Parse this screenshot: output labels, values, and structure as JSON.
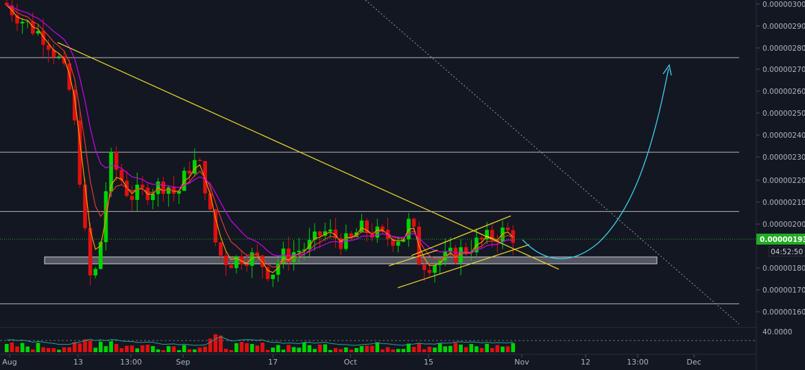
{
  "colors": {
    "background": "#131722",
    "up": "#00d600",
    "down": "#e01010",
    "axis_text": "#b2b5be",
    "level_line": "#b8b8b8",
    "trend_line": "#e6d22a",
    "ema_fast": "#ff9800",
    "ema_mid": "#e53935",
    "ema_slow": "#d500f9",
    "projection": "#3cc8e6",
    "current_price_bg": "#22ab23",
    "support_zone": "#8a8d96"
  },
  "chart_data": [
    {
      "type": "candlestick",
      "title": "",
      "x_ticks": [
        "Aug",
        "13",
        "13:00",
        "Sep",
        "17",
        "Oct",
        "15",
        "Nov",
        "12",
        "13:00",
        "Dec"
      ],
      "y_ticks": [
        "0.00000300",
        "0.00000290",
        "0.00000280",
        "0.00000270",
        "0.00000260",
        "0.00000250",
        "0.00000240",
        "0.00000230",
        "0.00000220",
        "0.00000210",
        "0.00000200",
        "0.00000180",
        "0.00000170",
        "0.00000160"
      ],
      "ylim": [
        1.55e-06,
        3e-06
      ],
      "price_path": [
        [
          0,
          3e-06
        ],
        [
          4,
          2.91e-06
        ],
        [
          8,
          2.84e-06
        ],
        [
          11,
          2.72e-06
        ],
        [
          13,
          2.56e-06
        ],
        [
          14,
          2.32e-06
        ],
        [
          15,
          2.1e-06
        ],
        [
          16,
          1.78e-06
        ],
        [
          17,
          1.72e-06
        ],
        [
          18,
          1.83e-06
        ],
        [
          19,
          2e-06
        ],
        [
          20,
          2.3e-06
        ],
        [
          22,
          2.22e-06
        ],
        [
          24,
          2.12e-06
        ],
        [
          27,
          2.14e-06
        ],
        [
          31,
          2.18e-06
        ],
        [
          33,
          2.12e-06
        ],
        [
          36,
          2.28e-06
        ],
        [
          38,
          2.24e-06
        ],
        [
          40,
          1.96e-06
        ],
        [
          41,
          1.86e-06
        ],
        [
          43,
          1.82e-06
        ],
        [
          46,
          1.85e-06
        ],
        [
          48,
          1.84e-06
        ],
        [
          50,
          1.8e-06
        ],
        [
          51,
          1.76e-06
        ],
        [
          53,
          1.84e-06
        ],
        [
          56,
          1.87e-06
        ],
        [
          59,
          1.9e-06
        ],
        [
          61,
          1.96e-06
        ],
        [
          63,
          1.94e-06
        ],
        [
          66,
          1.9e-06
        ],
        [
          68,
          1.97e-06
        ],
        [
          70,
          1.96e-06
        ],
        [
          72,
          1.94e-06
        ],
        [
          74,
          1.93e-06
        ],
        [
          77,
          1.94e-06
        ],
        [
          78,
          2.05e-06
        ],
        [
          79,
          1.84e-06
        ],
        [
          81,
          1.81e-06
        ],
        [
          84,
          1.83e-06
        ],
        [
          87,
          1.86e-06
        ],
        [
          89,
          1.89e-06
        ],
        [
          91,
          1.91e-06
        ],
        [
          93,
          1.93e-06
        ],
        [
          95,
          1.95e-06
        ],
        [
          96,
          1.96e-06
        ],
        [
          97,
          1.95e-06
        ],
        [
          98,
          1.93e-06
        ]
      ],
      "candle_count": 98,
      "current_price": "0.00000193",
      "countdown": "04:52:50",
      "horizontal_levels": [
        2.75e-06,
        2.32e-06,
        2.05e-06,
        1.63e-06
      ],
      "support_zone": [
        1.83e-06,
        1.86e-06
      ],
      "grid": false
    },
    {
      "type": "bar",
      "title": "",
      "y_ticks": [
        "40.0000"
      ],
      "bar_count": 98
    }
  ]
}
